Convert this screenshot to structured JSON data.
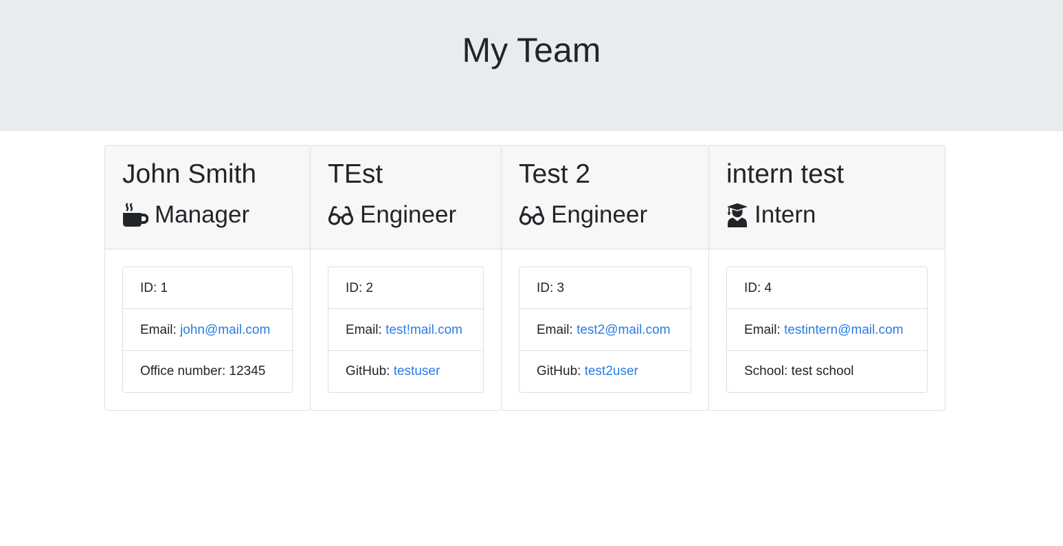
{
  "header": {
    "title": "My Team"
  },
  "employees": [
    {
      "name": "John Smith",
      "role": "Manager",
      "icon": "coffee-mug-icon",
      "id_label": "ID: 1",
      "email_label": "Email: ",
      "email": "john@mail.com",
      "extra_label": "Office number: 12345"
    },
    {
      "name": "TEst",
      "role": "Engineer",
      "icon": "glasses-icon",
      "id_label": "ID: 2",
      "email_label": "Email: ",
      "email": "test!mail.com",
      "extra_label": "GitHub: ",
      "extra_link": "testuser"
    },
    {
      "name": "Test 2",
      "role": "Engineer",
      "icon": "glasses-icon",
      "id_label": "ID: 3",
      "email_label": "Email: ",
      "email": "test2@mail.com",
      "extra_label": "GitHub: ",
      "extra_link": "test2user"
    },
    {
      "name": "intern test",
      "role": "Intern",
      "icon": "graduate-icon",
      "id_label": "ID: 4",
      "email_label": "Email: ",
      "email": "testintern@mail.com",
      "extra_label": "School: test school"
    }
  ],
  "colors": {
    "header_bg": "#e9ecef",
    "link": "#2a7be4",
    "text": "#212529"
  }
}
